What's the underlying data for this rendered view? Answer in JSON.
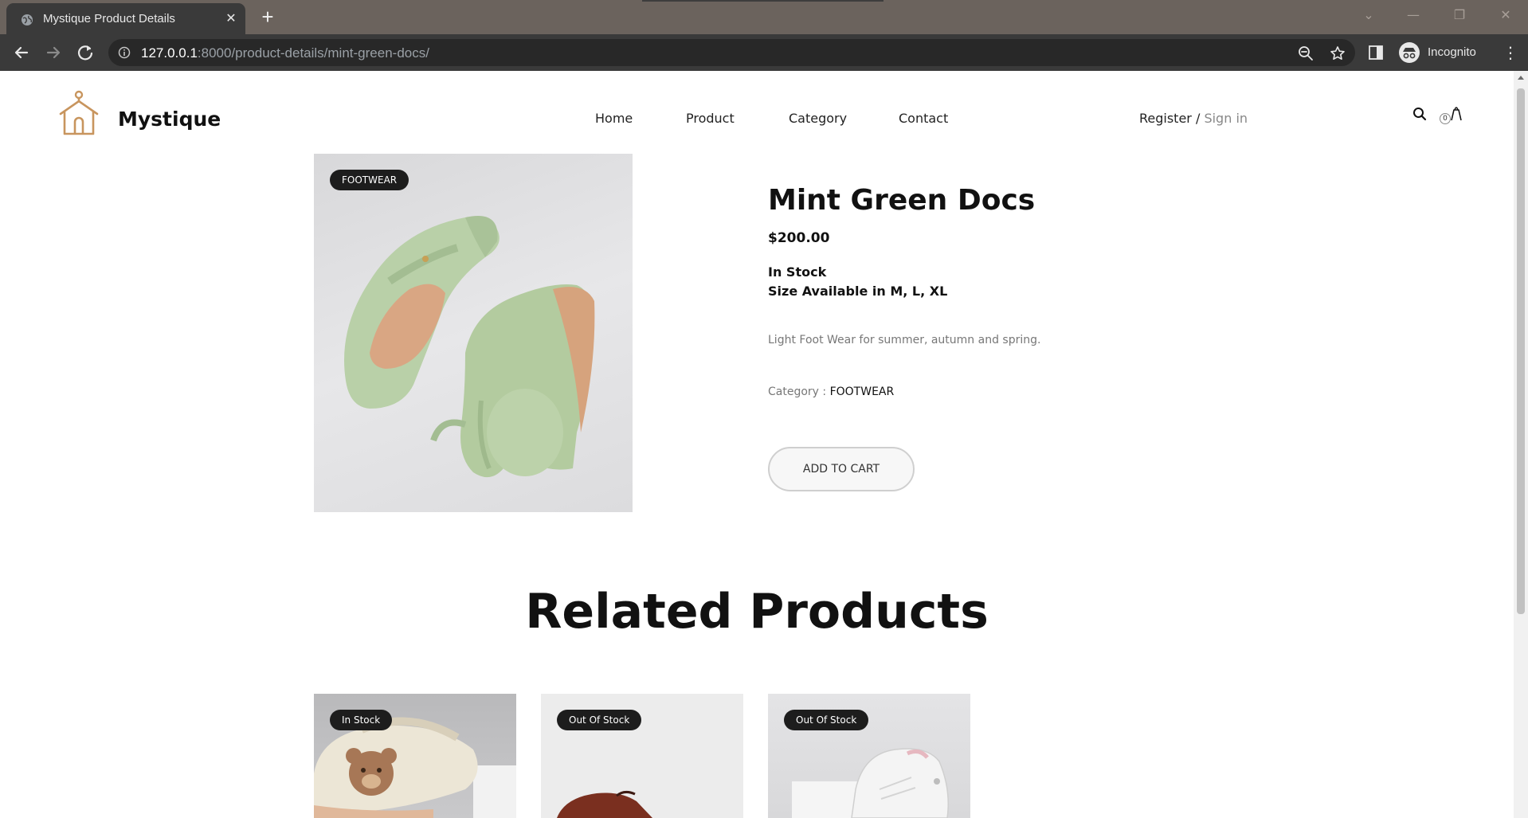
{
  "browser": {
    "tab_title": "Mystique Product Details",
    "url_host": "127.0.0.1",
    "url_rest": ":8000/product-details/mint-green-docs/",
    "profile_label": "Incognito"
  },
  "header": {
    "brand": "Mystique",
    "nav": [
      "Home",
      "Product",
      "Category",
      "Contact"
    ],
    "register": "Register",
    "separator": "/",
    "signin": "Sign in",
    "cart_count": "0"
  },
  "product": {
    "badge": "FOOTWEAR",
    "name": "Mint Green Docs",
    "price": "$200.00",
    "stock": "In Stock",
    "sizes": "Size Available in M, L, XL",
    "description": "Light Foot Wear for summer, autumn and spring.",
    "category_label": "Category :",
    "category_value": "FOOTWEAR",
    "add_to_cart": "ADD TO CART"
  },
  "related": {
    "title": "Related Products",
    "items": [
      {
        "badge": "In Stock"
      },
      {
        "badge": "Out Of Stock"
      },
      {
        "badge": "Out Of Stock"
      }
    ]
  },
  "colors": {
    "brand_accent": "#c8955e",
    "text_dark": "#111111",
    "muted": "#777777",
    "tab_bar": "#6b635d",
    "toolbar": "#3a3a3a",
    "mint_shoe": "#b9d0a8"
  }
}
